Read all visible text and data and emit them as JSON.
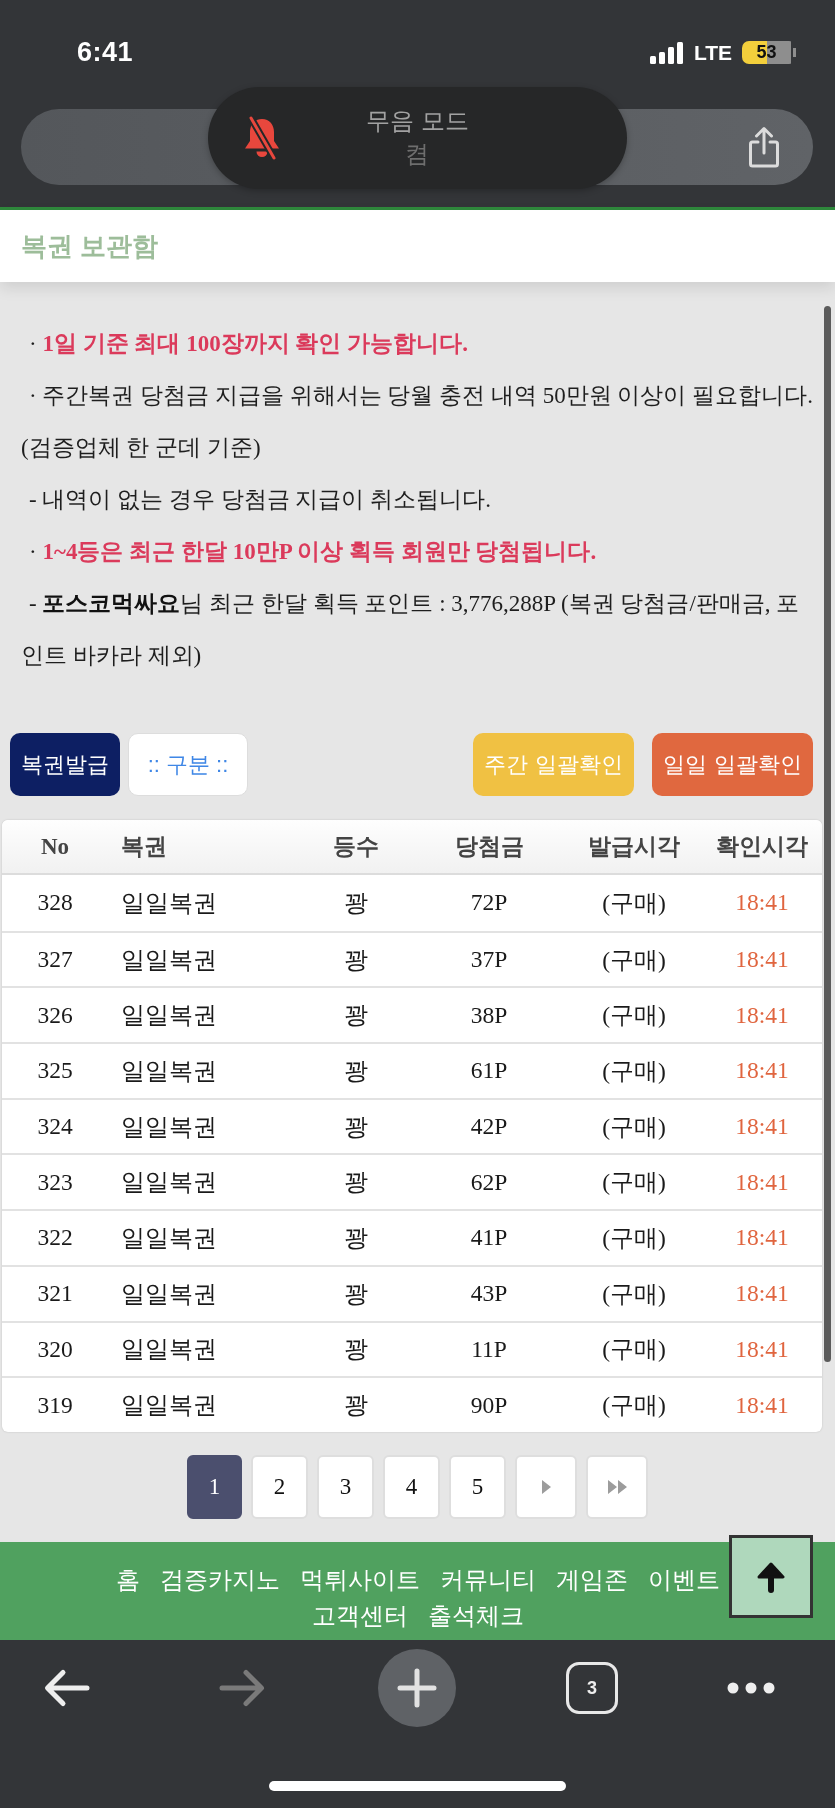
{
  "status_bar": {
    "time": "6:41",
    "network": "LTE",
    "battery": "53"
  },
  "silent_mode_banner": {
    "title": "무음 모드",
    "status": "켬"
  },
  "page_header": {
    "title": "복권 보관함"
  },
  "notices": [
    {
      "kind": "alert",
      "text": "· **1일 기준 최대 100장까지 확인 가능합니다.**"
    },
    {
      "kind": "info",
      "text": "· 주간복권 당첨금 지급을 위해서는 당월 충전 내역 50만원 이상이 필요합니다. (검증업체 한 군데 기준)"
    },
    {
      "kind": "info",
      "text": "- 내역이 없는 경우 당첨금 지급이 취소됩니다."
    },
    {
      "kind": "alert",
      "text": "· **1~4등은 최근 한달 10만P 이상 획득 회원만 당첨됩니다.**"
    },
    {
      "kind": "info",
      "text": "- **포스코먹싸요**님 최근 한달 획득 포인트 : 3,776,288P (복권 당첨금/판매금, 포인트 바카라 제외)"
    }
  ],
  "toolbar": {
    "issue_button": "복권발급",
    "category_select": {
      "value": ":: 구분 ::"
    },
    "weekly_check_button": "주간 일괄확인",
    "daily_check_button": "일일 일괄확인"
  },
  "table": {
    "columns": [
      "No",
      "복권",
      "등수",
      "당첨금",
      "발급시각",
      "확인시각"
    ],
    "rows": [
      [
        "328",
        "일일복권",
        "꽝",
        "72P",
        "(구매)",
        "18:41"
      ],
      [
        "327",
        "일일복권",
        "꽝",
        "37P",
        "(구매)",
        "18:41"
      ],
      [
        "326",
        "일일복권",
        "꽝",
        "38P",
        "(구매)",
        "18:41"
      ],
      [
        "325",
        "일일복권",
        "꽝",
        "61P",
        "(구매)",
        "18:41"
      ],
      [
        "324",
        "일일복권",
        "꽝",
        "42P",
        "(구매)",
        "18:41"
      ],
      [
        "323",
        "일일복권",
        "꽝",
        "62P",
        "(구매)",
        "18:41"
      ],
      [
        "322",
        "일일복권",
        "꽝",
        "41P",
        "(구매)",
        "18:41"
      ],
      [
        "321",
        "일일복권",
        "꽝",
        "43P",
        "(구매)",
        "18:41"
      ],
      [
        "320",
        "일일복권",
        "꽝",
        "11P",
        "(구매)",
        "18:41"
      ],
      [
        "319",
        "일일복권",
        "꽝",
        "90P",
        "(구매)",
        "18:41"
      ]
    ]
  },
  "pagination": {
    "pages": [
      {
        "label": "1",
        "selected": true
      },
      {
        "label": "2",
        "selected": false
      },
      {
        "label": "3",
        "selected": false
      },
      {
        "label": "4",
        "selected": false
      },
      {
        "label": "5",
        "selected": false
      }
    ],
    "controls": [
      {
        "kind": "next"
      },
      {
        "kind": "last"
      }
    ]
  },
  "footer_nav": [
    "홈",
    "검증카지노",
    "먹튀사이트",
    "커뮤니티",
    "게임존",
    "이벤트",
    "고객센터",
    "출석체크"
  ],
  "bottom_toolbar": {
    "back_disabled": false,
    "forward_disabled": true,
    "tab_count": "3"
  }
}
